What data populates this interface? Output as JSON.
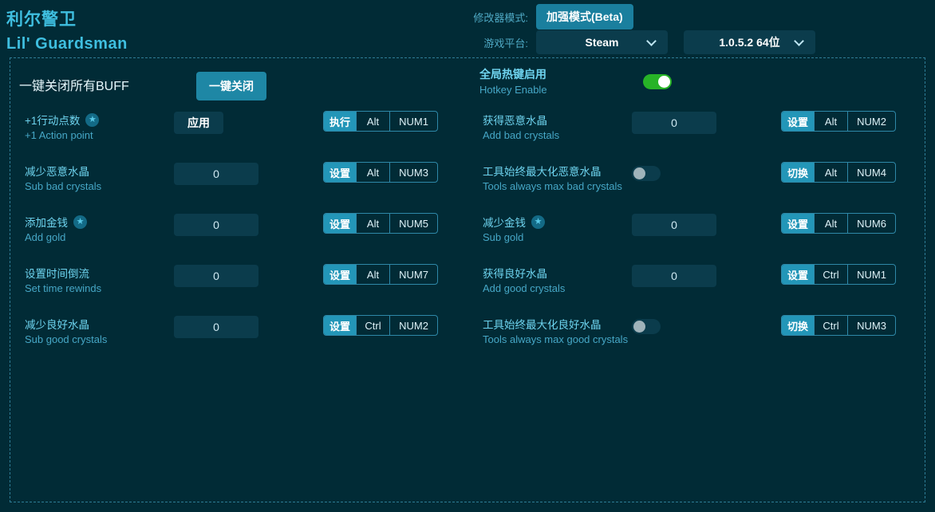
{
  "header": {
    "title_zh": "利尔警卫",
    "title_en": "Lil' Guardsman",
    "mode_label": "修改器模式:",
    "mode_value": "加强模式(Beta)",
    "platform_label": "游戏平台:",
    "platform_value": "Steam",
    "version_value": "1.0.5.2 64位"
  },
  "top": {
    "buff_label": "一键关闭所有BUFF",
    "buff_button": "一键关闭",
    "hotkey_zh": "全局热键启用",
    "hotkey_en": "Hotkey Enable",
    "hotkey_state": "on"
  },
  "colors": {
    "background": "#012b36",
    "accent": "#2396b8",
    "label": "#6fd4ef",
    "sublabel": "#46a7c6",
    "field": "#0b3c4c",
    "toggle_on": "#27b327",
    "toggle_off_knob": "#9fb3ba",
    "panel_border": "#2e7c95"
  },
  "rows_left": [
    {
      "zh": "+1行动点数",
      "en": "+1 Action point",
      "star": true,
      "control": "apply",
      "value": "应用",
      "hotkey": {
        "action": "执行",
        "mod": "Alt",
        "key": "NUM1"
      }
    },
    {
      "zh": "减少恶意水晶",
      "en": "Sub bad crystals",
      "star": false,
      "control": "value",
      "value": "0",
      "hotkey": {
        "action": "设置",
        "mod": "Alt",
        "key": "NUM3"
      }
    },
    {
      "zh": "添加金钱",
      "en": "Add gold",
      "star": true,
      "control": "value",
      "value": "0",
      "hotkey": {
        "action": "设置",
        "mod": "Alt",
        "key": "NUM5"
      }
    },
    {
      "zh": "设置时间倒流",
      "en": "Set time rewinds",
      "star": false,
      "control": "value",
      "value": "0",
      "hotkey": {
        "action": "设置",
        "mod": "Alt",
        "key": "NUM7"
      }
    },
    {
      "zh": "减少良好水晶",
      "en": "Sub good crystals",
      "star": false,
      "control": "value",
      "value": "0",
      "hotkey": {
        "action": "设置",
        "mod": "Ctrl",
        "key": "NUM2"
      }
    }
  ],
  "rows_right": [
    {
      "zh": "获得恶意水晶",
      "en": "Add bad crystals",
      "star": false,
      "control": "value",
      "value": "0",
      "hotkey": {
        "action": "设置",
        "mod": "Alt",
        "key": "NUM2"
      }
    },
    {
      "zh": "工具始终最大化恶意水晶",
      "en": "Tools always max bad crystals",
      "star": false,
      "control": "switch",
      "value": "off",
      "hotkey": {
        "action": "切换",
        "mod": "Alt",
        "key": "NUM4"
      }
    },
    {
      "zh": "减少金钱",
      "en": "Sub gold",
      "star": true,
      "control": "value",
      "value": "0",
      "hotkey": {
        "action": "设置",
        "mod": "Alt",
        "key": "NUM6"
      }
    },
    {
      "zh": "获得良好水晶",
      "en": "Add good crystals",
      "star": false,
      "control": "value",
      "value": "0",
      "hotkey": {
        "action": "设置",
        "mod": "Ctrl",
        "key": "NUM1"
      }
    },
    {
      "zh": "工具始终最大化良好水晶",
      "en": "Tools always max good crystals",
      "star": false,
      "control": "switch",
      "value": "off",
      "hotkey": {
        "action": "切换",
        "mod": "Ctrl",
        "key": "NUM3"
      }
    }
  ]
}
